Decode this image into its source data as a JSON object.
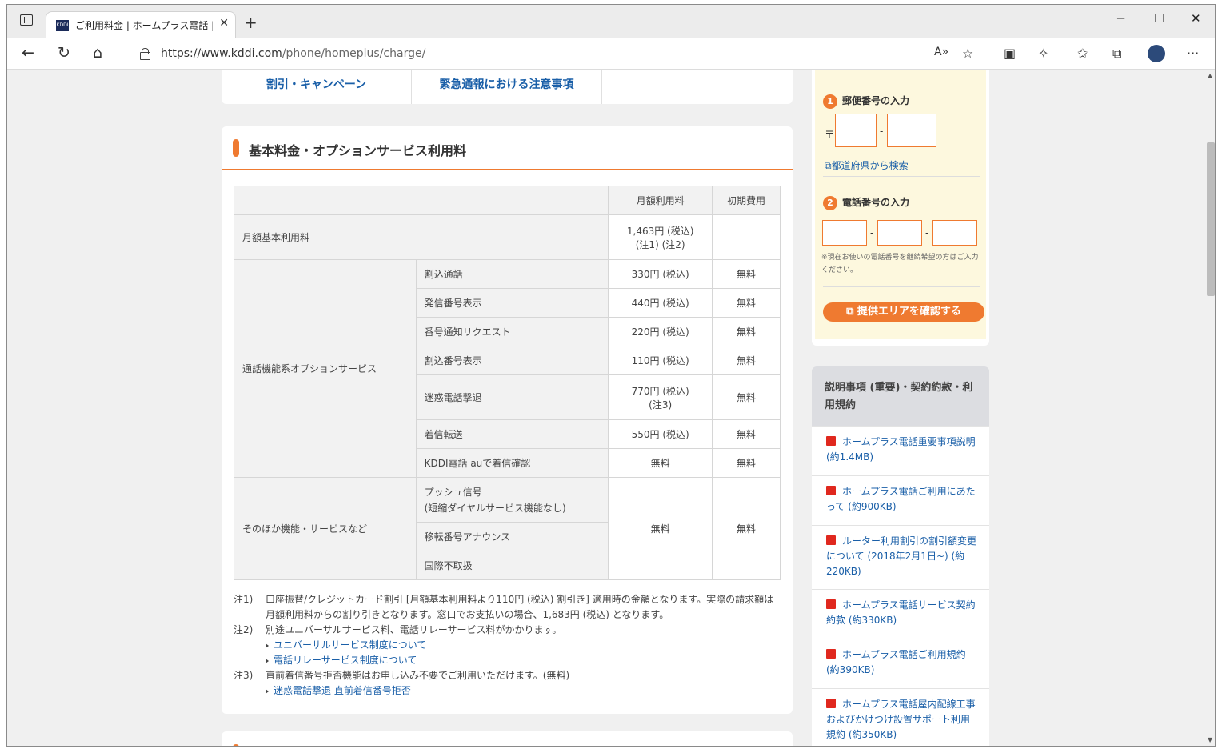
{
  "browser": {
    "tab_title": "ご利用料金 | ホームプラス電話 | KDDI",
    "tab_favicon_text": "KDDI",
    "url_host": "https://www.kddi.com",
    "url_path": "/phone/homeplus/charge/",
    "new_tab": "+",
    "close_tab": "✕",
    "minimize": "─",
    "maximize": "☐",
    "close_window": "✕",
    "icons": [
      "back-icon",
      "refresh-icon",
      "home-icon",
      "lock-icon",
      "read-aloud-icon",
      "add-favorite-icon",
      "screencast-icon",
      "extensions-icon",
      "favorites-icon",
      "collections-icon",
      "profile-icon",
      "more-icon"
    ]
  },
  "topnav": {
    "items": [
      {
        "label": "割引・キャンペーン"
      },
      {
        "label": "緊急通報における注意事項"
      }
    ]
  },
  "section": {
    "title": "基本料金・オプションサービス利用料"
  },
  "table": {
    "header": {
      "monthly": "月額利用料",
      "initial": "初期費用"
    },
    "basic": {
      "label": "月額基本利用料",
      "monthly_line1": "1,463円 (税込)",
      "monthly_line2": "(注1) (注2)",
      "initial": "-"
    },
    "call_options": {
      "group": "通話機能系オプションサービス",
      "rows": [
        {
          "name": "割込通話",
          "monthly": "330円 (税込)",
          "initial": "無料"
        },
        {
          "name": "発信番号表示",
          "monthly": "440円 (税込)",
          "initial": "無料"
        },
        {
          "name": "番号通知リクエスト",
          "monthly": "220円 (税込)",
          "initial": "無料"
        },
        {
          "name": "割込番号表示",
          "monthly": "110円 (税込)",
          "initial": "無料"
        },
        {
          "name": "迷惑電話撃退",
          "monthly": "770円 (税込)",
          "monthly_note": "(注3)",
          "initial": "無料"
        },
        {
          "name": "着信転送",
          "monthly": "550円 (税込)",
          "initial": "無料"
        },
        {
          "name": "KDDI電話 auで着信確認",
          "monthly": "無料",
          "initial": "無料"
        }
      ]
    },
    "other": {
      "group": "そのほか機能・サービスなど",
      "rows": [
        {
          "name_line1": "プッシュ信号",
          "name_line2": "(短縮ダイヤルサービス機能なし)"
        },
        {
          "name": "移転番号アナウンス"
        },
        {
          "name": "国際不取扱"
        }
      ],
      "monthly": "無料",
      "initial": "無料"
    }
  },
  "notes": {
    "n1_label": "注1)",
    "n1_line1": "口座振替/クレジットカード割引 [月額基本利用料より110円 (税込) 割引き] 適用時の金額となります。実際の請求額は",
    "n1_line2": "月額利用料からの割り引きとなります。窓口でお支払いの場合、1,683円 (税込) となります。",
    "n2_label": "注2)",
    "n2_text": "別途ユニバーサルサービス料、電話リレーサービス料がかかります。",
    "n2_link1": "ユニバーサルサービス制度について",
    "n2_link2": "電話リレーサービス制度について",
    "n3_label": "注3)",
    "n3_text": "直前着信番号拒否機能はお申し込み不要でご利用いただけます。(無料)",
    "n3_link": "迷惑電話撃退 直前着信番号拒否"
  },
  "area_check": {
    "step1": {
      "num": "1",
      "label": "郵便番号の入力",
      "prefix": "〒",
      "sep": "-"
    },
    "pref_link": "都道府県から検索",
    "step2": {
      "num": "2",
      "label": "電話番号の入力",
      "sep": "-"
    },
    "note": "※現在お使いの電話番号を継続希望の方はご入力ください。",
    "button": "提供エリアを確認する"
  },
  "docs": {
    "heading": "説明事項 (重要)・契約約款・利用規約",
    "items": [
      {
        "label": "ホームプラス電話重要事項説明 (約1.4MB)"
      },
      {
        "label": "ホームプラス電話ご利用にあたって (約900KB)"
      },
      {
        "label": "ルーター利用割引の割引額変更について (2018年2月1日~) (約220KB)"
      },
      {
        "label": "ホームプラス電話サービス契約約款 (約330KB)"
      },
      {
        "label": "ホームプラス電話ご利用規約 (約390KB)"
      },
      {
        "label": "ホームプラス電話屋内配線工事およびかけつけ設置サポート利用規約 (約350KB)"
      }
    ]
  }
}
